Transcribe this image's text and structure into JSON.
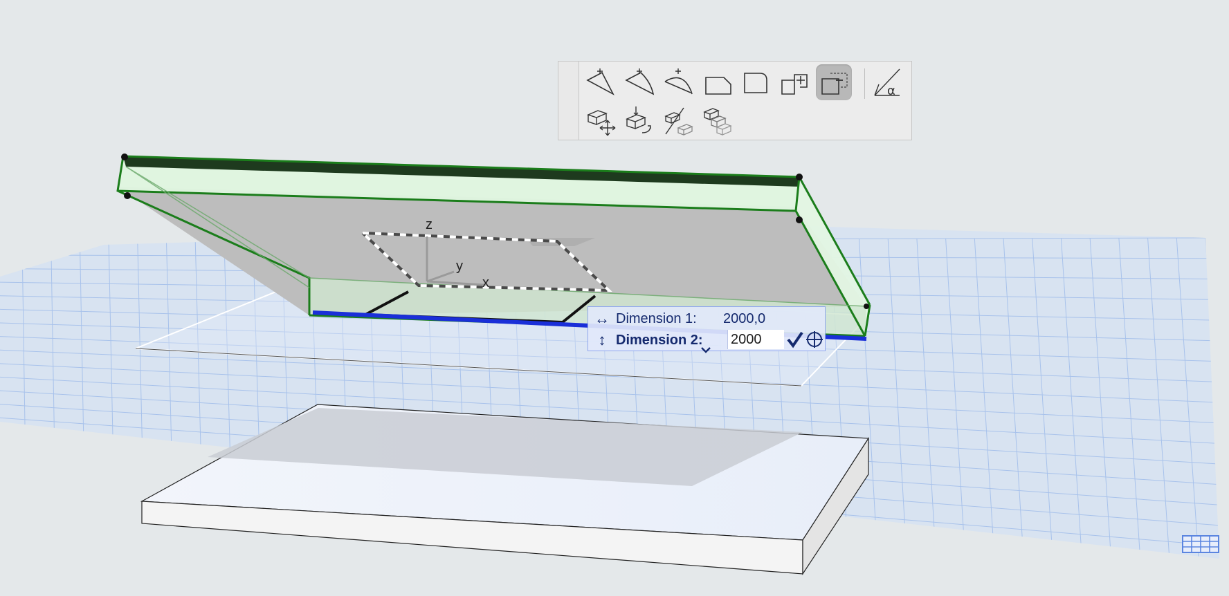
{
  "scene": {
    "axis_labels": {
      "z": "z",
      "y": "y",
      "x": "x"
    }
  },
  "palette": {
    "row1": [
      "corner-chamfer-tool-icon",
      "corner-fillet-tool-icon",
      "curved-corner-tool-icon",
      "chamfer-corner-tool-icon",
      "fillet-corner-tool-icon",
      "add-to-polygon-icon",
      "subtract-from-polygon-icon",
      "angle-tool-icon"
    ],
    "row2": [
      "move-element-icon",
      "rotate-element-icon",
      "mirror-element-icon",
      "multiply-element-icon"
    ],
    "active_tool": "subtract-from-polygon-icon"
  },
  "dimension_box": {
    "dim1": {
      "label": "Dimension 1:",
      "value": "2000,0"
    },
    "dim2": {
      "label": "Dimension 2:",
      "value": "2000"
    }
  },
  "colors": {
    "grid_plane": "#d9e4f3",
    "grid_lines": "#a9c3ec",
    "slab_edge": "#1c7a1c",
    "selection_blue": "#1a2fd8",
    "dialog_border": "#8fa6ee"
  }
}
